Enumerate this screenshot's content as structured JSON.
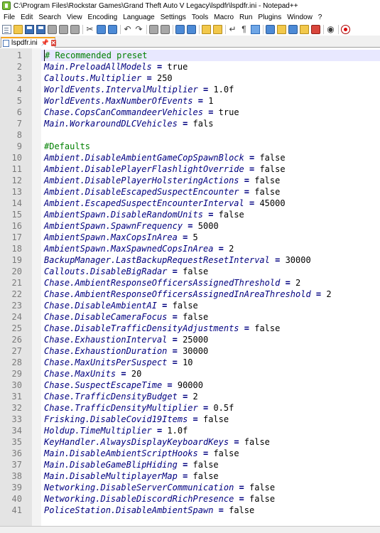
{
  "window": {
    "title": "C:\\Program Files\\Rockstar Games\\Grand Theft Auto V Legacy\\lspdfr\\lspdfr.ini - Notepad++"
  },
  "menu": [
    "File",
    "Edit",
    "Search",
    "View",
    "Encoding",
    "Language",
    "Settings",
    "Tools",
    "Macro",
    "Run",
    "Plugins",
    "Window",
    "?"
  ],
  "toolbar": {
    "buttons": [
      "new-file-icon",
      "open-file-icon",
      "save-icon",
      "save-all-icon",
      "close-icon",
      "close-all-icon",
      "print-icon",
      "cut-icon",
      "copy-icon",
      "paste-icon",
      "undo-icon",
      "redo-icon",
      "find-icon",
      "replace-icon",
      "zoom-in-icon",
      "zoom-out-icon",
      "sync-vertical-icon",
      "sync-horizontal-icon",
      "word-wrap-icon",
      "show-all-chars-icon",
      "indent-guide-icon",
      "user-language-icon",
      "document-map-icon",
      "function-list-icon",
      "folder-workspace-icon",
      "document-list-icon",
      "monitoring-icon",
      "record-macro-icon"
    ]
  },
  "tab": {
    "label": "lspdfr.ini",
    "pin": "📌",
    "close": "✕"
  },
  "editor": {
    "current_line": 1,
    "lines": [
      {
        "n": "1",
        "type": "comment",
        "text": "# Recommended preset"
      },
      {
        "n": "2",
        "type": "kv",
        "key": "Main.PreloadAllModels",
        "value": "true"
      },
      {
        "n": "3",
        "type": "kv",
        "key": "Callouts.Multiplier",
        "value": "250"
      },
      {
        "n": "4",
        "type": "kv",
        "key": "WorldEvents.IntervalMultiplier",
        "value": "1.0f"
      },
      {
        "n": "5",
        "type": "kv",
        "key": "WorldEvents.MaxNumberOfEvents",
        "value": "1"
      },
      {
        "n": "6",
        "type": "kv",
        "key": "Chase.CopsCanCommandeerVehicles",
        "value": "true"
      },
      {
        "n": "7",
        "type": "kv",
        "key": "Main.WorkaroundDLCVehicles",
        "value": "fals"
      },
      {
        "n": "8",
        "type": "blank",
        "text": ""
      },
      {
        "n": "9",
        "type": "comment",
        "text": "#Defaults"
      },
      {
        "n": "10",
        "type": "kv",
        "key": "Ambient.DisableAmbientGameCopSpawnBlock",
        "value": "false"
      },
      {
        "n": "11",
        "type": "kv",
        "key": "Ambient.DisablePlayerFlashlightOverride",
        "value": "false"
      },
      {
        "n": "12",
        "type": "kv",
        "key": "Ambient.DisablePlayerHolsteringActions",
        "value": "false"
      },
      {
        "n": "13",
        "type": "kv",
        "key": "Ambient.DisableEscapedSuspectEncounter",
        "value": "false"
      },
      {
        "n": "14",
        "type": "kv",
        "key": "Ambient.EscapedSuspectEncounterInterval",
        "value": "45000"
      },
      {
        "n": "15",
        "type": "kv",
        "key": "AmbientSpawn.DisableRandomUnits",
        "value": "false"
      },
      {
        "n": "16",
        "type": "kv",
        "key": "AmbientSpawn.SpawnFrequency",
        "value": "5000"
      },
      {
        "n": "17",
        "type": "kv",
        "key": "AmbientSpawn.MaxCopsInArea",
        "value": "5"
      },
      {
        "n": "18",
        "type": "kv",
        "key": "AmbientSpawn.MaxSpawnedCopsInArea",
        "value": "2"
      },
      {
        "n": "19",
        "type": "kv",
        "key": "BackupManager.LastBackupRequestResetInterval",
        "value": "30000"
      },
      {
        "n": "20",
        "type": "kv",
        "key": "Callouts.DisableBigRadar",
        "value": "false"
      },
      {
        "n": "21",
        "type": "kv",
        "key": "Chase.AmbientResponseOfficersAssignedThreshold",
        "value": "2"
      },
      {
        "n": "22",
        "type": "kv",
        "key": "Chase.AmbientResponseOfficersAssignedInAreaThreshold",
        "value": "2"
      },
      {
        "n": "23",
        "type": "kv",
        "key": "Chase.DisableAmbientAI",
        "value": "false"
      },
      {
        "n": "24",
        "type": "kv",
        "key": "Chase.DisableCameraFocus",
        "value": "false"
      },
      {
        "n": "25",
        "type": "kv",
        "key": "Chase.DisableTrafficDensityAdjustments",
        "value": "false"
      },
      {
        "n": "26",
        "type": "kv",
        "key": "Chase.ExhaustionInterval",
        "value": "25000"
      },
      {
        "n": "27",
        "type": "kv",
        "key": "Chase.ExhaustionDuration",
        "value": "30000"
      },
      {
        "n": "28",
        "type": "kv",
        "key": "Chase.MaxUnitsPerSuspect",
        "value": "10"
      },
      {
        "n": "29",
        "type": "kv",
        "key": "Chase.MaxUnits",
        "value": "20"
      },
      {
        "n": "30",
        "type": "kv",
        "key": "Chase.SuspectEscapeTime",
        "value": "90000"
      },
      {
        "n": "31",
        "type": "kv",
        "key": "Chase.TrafficDensityBudget",
        "value": "2"
      },
      {
        "n": "32",
        "type": "kv",
        "key": "Chase.TrafficDensityMultiplier",
        "value": "0.5f"
      },
      {
        "n": "33",
        "type": "kv",
        "key": "Frisking.DisableCovid19Items",
        "value": "false"
      },
      {
        "n": "34",
        "type": "kv",
        "key": "Holdup.TimeMultiplier",
        "value": "1.0f"
      },
      {
        "n": "35",
        "type": "kv",
        "key": "KeyHandler.AlwaysDisplayKeyboardKeys",
        "value": "false"
      },
      {
        "n": "36",
        "type": "kv",
        "key": "Main.DisableAmbientScriptHooks",
        "value": "false"
      },
      {
        "n": "37",
        "type": "kv",
        "key": "Main.DisableGameBlipHiding",
        "value": "false"
      },
      {
        "n": "38",
        "type": "kv",
        "key": "Main.DisableMultiplayerMap",
        "value": "false"
      },
      {
        "n": "39",
        "type": "kv",
        "key": "Networking.DisableServerCommunication",
        "value": "false"
      },
      {
        "n": "40",
        "type": "kv",
        "key": "Networking.DisableDiscordRichPresence",
        "value": "false"
      },
      {
        "n": "41",
        "type": "kv",
        "key": "PoliceStation.DisableAmbientSpawn",
        "value": "false"
      }
    ]
  },
  "colors": {
    "key": "#000080",
    "comment": "#008000",
    "current_line_bg": "#e8e8ff",
    "gutter_bg": "#e4e4e4",
    "tab_accent": "#f7a31b"
  }
}
